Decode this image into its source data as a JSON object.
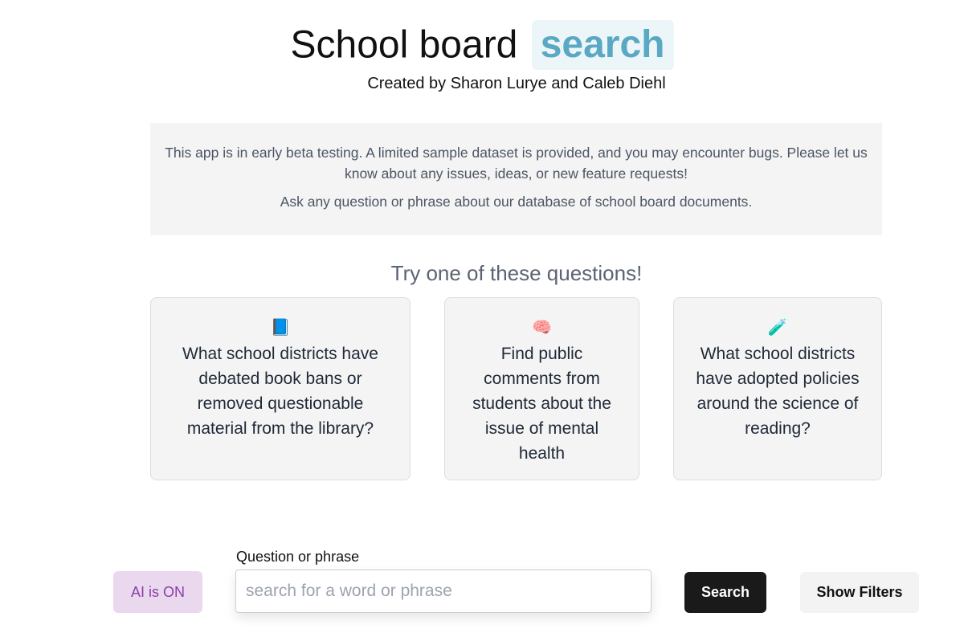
{
  "header": {
    "title_main": "School board",
    "title_highlight": "search",
    "credits": "Created by Sharon Lurye and Caleb Diehl"
  },
  "notice": {
    "line1": "This app is in early beta testing. A limited sample dataset is provided, and you may encounter bugs. Please let us know about any issues, ideas, or new feature requests!",
    "line2": "Ask any question or phrase about our database of school board documents."
  },
  "suggestions": {
    "heading": "Try one of these questions!",
    "cards": [
      {
        "icon": "book-icon",
        "emoji": "📘",
        "question": "What school districts have debated book bans or removed questionable material from the library?"
      },
      {
        "icon": "brain-icon",
        "emoji": "🧠",
        "question": "Find public comments from students about the issue of mental health"
      },
      {
        "icon": "test-tube-icon",
        "emoji": "🧪",
        "question": "What school districts have adopted policies around the science of reading?"
      }
    ]
  },
  "search_bar": {
    "ai_toggle_label": "AI is ON",
    "field_label": "Question or phrase",
    "value": "",
    "placeholder": "search for a word or phrase",
    "search_label": "Search",
    "filters_label": "Show Filters"
  },
  "colors": {
    "highlight_bg": "#ecf5f8",
    "highlight_text": "#5aa8c4",
    "ai_toggle_bg": "#ead8ef",
    "ai_toggle_text": "#8a3fa6",
    "search_button_bg": "#1a1a1a"
  }
}
